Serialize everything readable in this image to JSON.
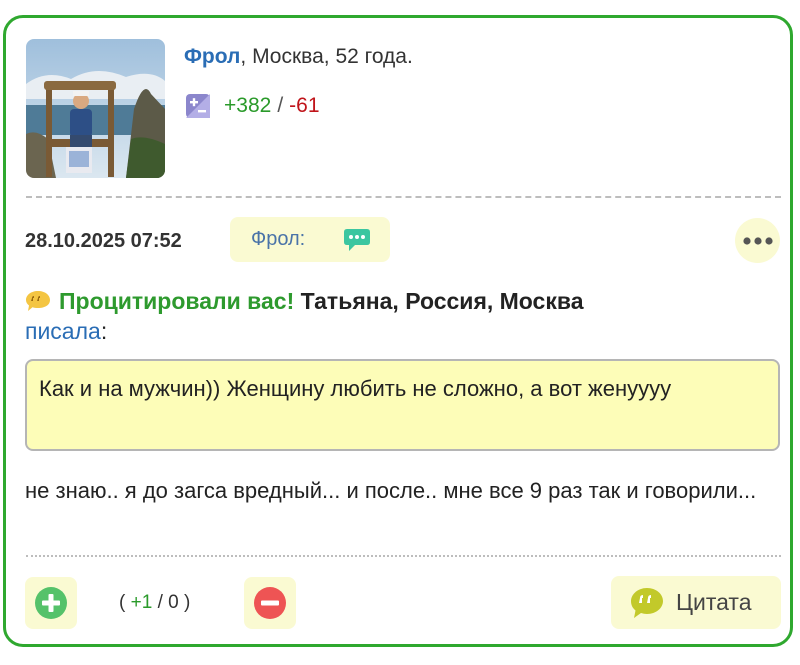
{
  "author": {
    "name": "Фрол",
    "details": ", Москва, 52 года.",
    "rating": {
      "positive": "+382",
      "separator": "/",
      "negative": "-61"
    }
  },
  "post": {
    "date": "28.10.2025 07:52",
    "reply_label": "Фрол:",
    "quote_header": {
      "label": "Процитировали вас!",
      "user": "Татьяна, Россия, Москва",
      "wrote": "писала",
      "colon": ":"
    },
    "quote_text": "Как и на мужчин)) Женщину любить не сложно, а вот женуууу",
    "message": "не знаю.. я до загса вредный... и после.. мне все 9 раз так и говорили..."
  },
  "votes": {
    "open": "(",
    "up": "+1",
    "sep": "/",
    "down": "0",
    "close": ")"
  },
  "actions": {
    "quote_label": "Цитата"
  },
  "colors": {
    "border": "#2fa82f",
    "button_bg": "#fafad2",
    "quote_bg": "#fdfdb8",
    "link": "#2a6db5",
    "positive": "#2a9a2a",
    "negative": "#c0141a"
  }
}
